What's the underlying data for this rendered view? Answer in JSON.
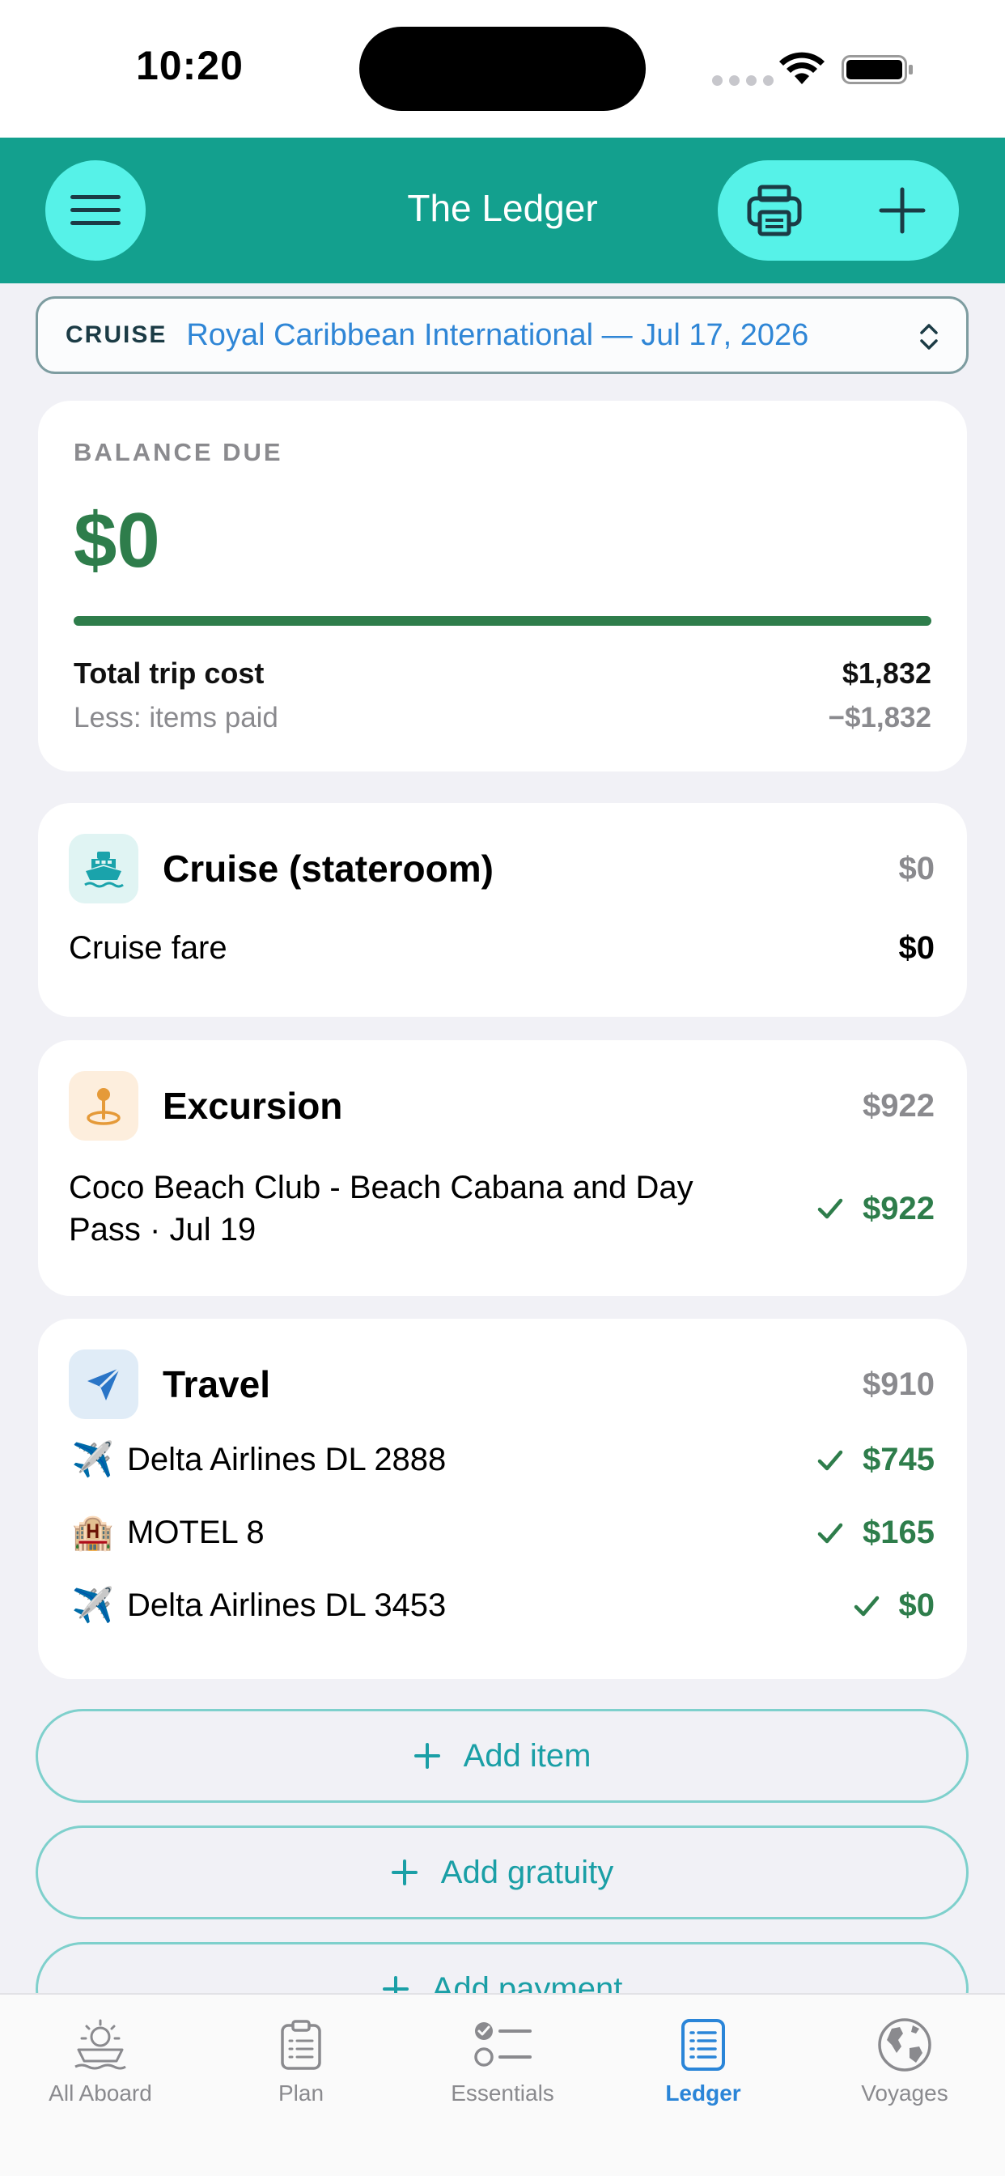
{
  "status": {
    "time": "10:20"
  },
  "header": {
    "title": "The Ledger",
    "icons": {
      "menu": "hamburger-icon",
      "print": "printer-icon",
      "add": "plus-icon"
    }
  },
  "cruise_selector": {
    "tag": "CRUISE",
    "value": "Royal Caribbean International — Jul 17, 2026"
  },
  "balance": {
    "label": "BALANCE DUE",
    "amount": "$0",
    "progress_fraction": 1.0,
    "total_label": "Total trip cost",
    "total_value": "$1,832",
    "paid_label": "Less: items paid",
    "paid_value": "−$1,832"
  },
  "categories": [
    {
      "title": "Cruise (stateroom)",
      "total": "$0",
      "icon": "ship-icon",
      "items": [
        {
          "name": "Cruise fare",
          "amount": "$0",
          "paid": false
        }
      ]
    },
    {
      "title": "Excursion",
      "total": "$922",
      "icon": "map-pin-icon",
      "items": [
        {
          "name": "Coco Beach Club - Beach Cabana and Day Pass · Jul 19",
          "amount": "$922",
          "paid": true
        }
      ]
    },
    {
      "title": "Travel",
      "total": "$910",
      "icon": "paper-plane-icon",
      "items": [
        {
          "emoji": "✈️",
          "name": "Delta Airlines DL 2888",
          "amount": "$745",
          "paid": true
        },
        {
          "emoji": "🏨",
          "name": "MOTEL 8",
          "amount": "$165",
          "paid": true
        },
        {
          "emoji": "✈️",
          "name": "Delta Airlines DL 3453",
          "amount": "$0",
          "paid": true
        }
      ]
    }
  ],
  "actions": {
    "add_item": "Add item",
    "add_gratuity": "Add gratuity",
    "add_payment": "Add payment"
  },
  "tabs": [
    {
      "label": "All Aboard",
      "icon": "ship-sun-icon",
      "active": false
    },
    {
      "label": "Plan",
      "icon": "clipboard-icon",
      "active": false
    },
    {
      "label": "Essentials",
      "icon": "checklist-icon",
      "active": false
    },
    {
      "label": "Ledger",
      "icon": "ledger-icon",
      "active": true
    },
    {
      "label": "Voyages",
      "icon": "globe-icon",
      "active": false
    }
  ],
  "colors": {
    "header": "#13a08e",
    "header_button": "#56f2e8",
    "paid_green": "#2e7d4b",
    "link_blue": "#2f86d6",
    "active_tab": "#2a85d8",
    "action_text": "#1a9fa6"
  }
}
